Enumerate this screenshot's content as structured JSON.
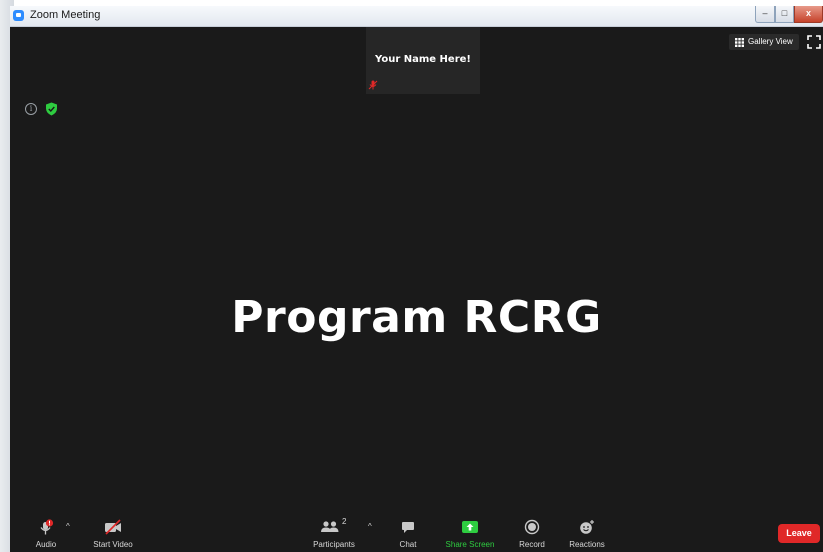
{
  "window": {
    "title": "Zoom Meeting",
    "min": "–",
    "max": "□",
    "close": "x"
  },
  "video_tile": {
    "name": "Your Name Here!"
  },
  "view": {
    "gallery_label": "Gallery View"
  },
  "info": {
    "glyph": "i"
  },
  "shared": {
    "text": "Program RCRG"
  },
  "toolbar": {
    "audio": "Audio",
    "start_video": "Start Video",
    "participants": "Participants",
    "participants_count": "2",
    "chat": "Chat",
    "share_screen": "Share Screen",
    "record": "Record",
    "reactions": "Reactions",
    "leave": "Leave",
    "caret": "^"
  },
  "colors": {
    "background": "#1a1a1a",
    "share_green": "#2ecc40",
    "leave_red": "#e02828",
    "mute_red": "#e02828",
    "accent_blue": "#2d8cff"
  },
  "icons": [
    "zoom-app-icon",
    "muted-mic-icon",
    "grid-icon",
    "fullscreen-icon",
    "info-icon",
    "shield-icon",
    "mic-icon",
    "video-off-icon",
    "participants-icon",
    "chat-icon",
    "share-screen-icon",
    "record-icon",
    "reactions-icon",
    "caret-up-icon"
  ]
}
